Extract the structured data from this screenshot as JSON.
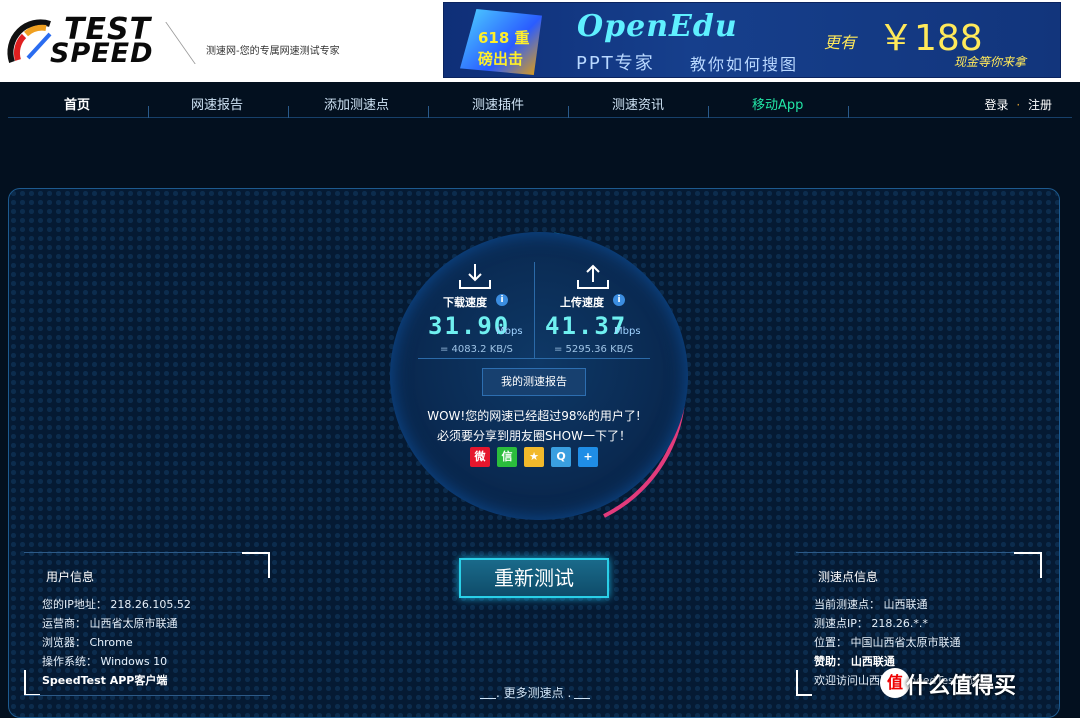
{
  "logo": {
    "test": "TEST",
    "speed": "SPEED"
  },
  "slogan": "测速网-您的专属网速测试专家",
  "ad": {
    "badge": "618 重磅出击",
    "title": "OpenEdu",
    "sub_left": "PPT专家",
    "sub_right": "教你如何搜图",
    "only": "更有",
    "price": "￥188",
    "hurry": "现金等你来拿"
  },
  "nav": {
    "items": [
      "首页",
      "网速报告",
      "添加测速点",
      "测速插件",
      "测速资讯",
      "移动App"
    ],
    "login": "登录",
    "dot": "·",
    "register": "注册"
  },
  "speedtest": {
    "download_label": "下载速度",
    "download_value": "31.90",
    "download_unit": "Mbps",
    "download_kbs": "= 4083.2  KB/S",
    "upload_label": "上传速度",
    "upload_value": "41.37",
    "upload_unit": "Mbps",
    "upload_kbs": "= 5295.36  KB/S",
    "report_button": "我的测速报告",
    "wow_line1": "WOW!您的网速已经超过98%的用户了!",
    "wow_line2": "必须要分享到朋友圈SHOW一下了！",
    "retest_button": "重新测试",
    "more": ". 更多测速点 ."
  },
  "share": [
    {
      "name": "weibo-icon",
      "color": "#e6162d",
      "glyph": "微"
    },
    {
      "name": "wechat-icon",
      "color": "#2bbd3c",
      "glyph": "信"
    },
    {
      "name": "qzone-icon",
      "color": "#f2b92b",
      "glyph": "★"
    },
    {
      "name": "tencent-weibo-icon",
      "color": "#3a9fe0",
      "glyph": "Q"
    },
    {
      "name": "more-share-icon",
      "color": "#1f8de6",
      "glyph": "+"
    }
  ],
  "user_info": {
    "title": "用户信息",
    "rows": [
      "您的IP地址：  218.26.105.52",
      "运营商：  山西省太原市联通",
      "浏览器：  Chrome",
      "操作系统：  Windows 10"
    ],
    "app": "SpeedTest APP客户端"
  },
  "node_info": {
    "title": "测速点信息",
    "rows": [
      "当前测速点：  山西联通",
      "测速点IP：  218.26.*.*",
      "位置：  中国山西省太原市联通"
    ],
    "sponsor": "赞助：  山西联通",
    "welcome": "欢迎访问山西联通SpeedTest测速点"
  },
  "watermark": "什么值得买"
}
